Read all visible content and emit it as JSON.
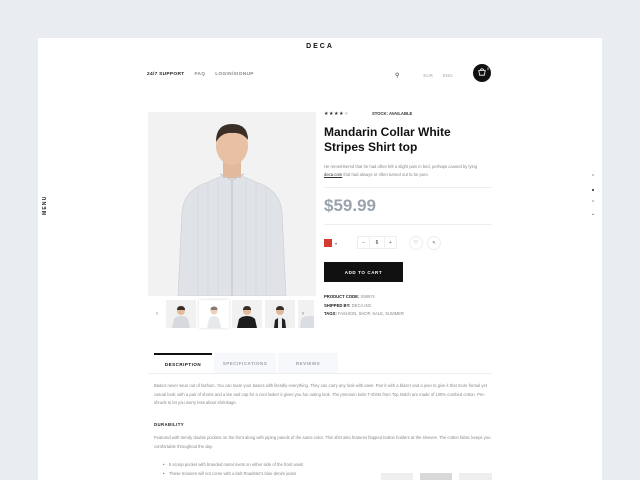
{
  "brand": "DECA",
  "nav": {
    "support": "24/7 SUPPORT",
    "faq": "FAQ",
    "login": "LOGIN/SIGNUP"
  },
  "right_nav": {
    "currency": "EUR",
    "language": "ENG"
  },
  "cart": {
    "count": "0"
  },
  "side_menu": {
    "label": "MENU"
  },
  "product": {
    "rating": 4,
    "stock_label": "STOCK: AVAILABLE",
    "title": "Mandarin Collar White Stripes Shirt top",
    "description_1": "He remembered that he had often felt a slight pain in bed, perhaps caused by lying",
    "description_link": "deca.com",
    "description_2": "that had always or often turned out to be pure.",
    "price": "$59.99",
    "quantity": "6",
    "add_to_cart": "ADD TO CART",
    "product_code_label": "PRODUCT CODE:",
    "product_code": "S5997s",
    "shipped_by_label": "SHIPPED BY:",
    "shipped_by": "DECA.INC",
    "tags_label": "TAGS:",
    "tags": "FASHION, SHOP, SALE, SUMMER",
    "color": "#d43a2e"
  },
  "tabs": [
    "DESCRIPTION",
    "SPECIFICATIONS",
    "REVIEWS"
  ],
  "content": {
    "paragraph_1": "Basics never wear out of fashion. You can team your basics with literally everything. They can carry any look with ease. Pair it with a blazer and a jean to give it that more formal yet casual look; with a pair of shorts and a tee and cap for a cool looker it gives you fun outing look. The premium knits T-shirts from Top Notch are made of 100% combed cotton. Pre-shrunk to let you worry less about shrinkage.",
    "durability_heading": "DURABILITY",
    "paragraph_2": "Featured with trendy double pockets on the front along with piping panels of the same color. This shirt also features flapped button holders at the sleeves. The cotton fabric keeps you comfortable throughout the day.",
    "bullets": [
      "5 scoop pocket with branded metal rivets on either side of the front waist",
      "These trousers will not come with a belt Roadster's blue denim jeans"
    ]
  }
}
